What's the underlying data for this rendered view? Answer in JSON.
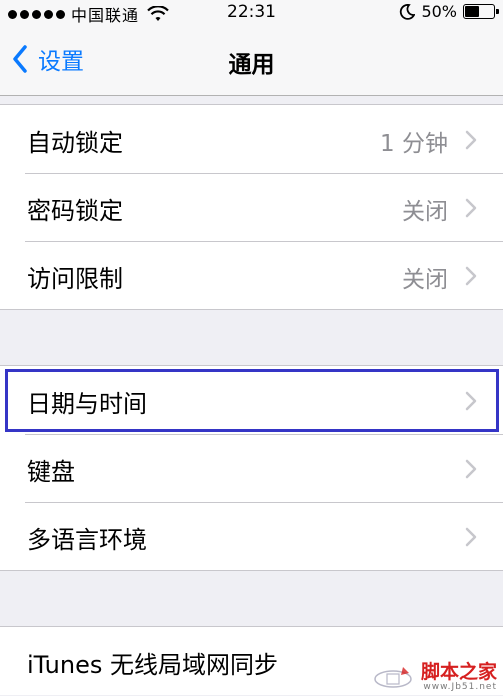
{
  "status_bar": {
    "carrier": "中国联通",
    "time": "22:31",
    "battery_percent_label": "50%",
    "battery_level": 0.5,
    "icons": [
      "signal-dots-icon",
      "wifi-icon",
      "moon-icon",
      "battery-icon"
    ]
  },
  "nav": {
    "back_label": "设置",
    "title": "通用"
  },
  "groups": [
    {
      "rows": [
        {
          "label": "自动锁定",
          "value": "1 分钟"
        },
        {
          "label": "密码锁定",
          "value": "关闭"
        },
        {
          "label": "访问限制",
          "value": "关闭"
        }
      ]
    },
    {
      "rows": [
        {
          "label": "日期与时间",
          "value": ""
        },
        {
          "label": "键盘",
          "value": ""
        },
        {
          "label": "多语言环境",
          "value": ""
        }
      ]
    },
    {
      "rows": [
        {
          "label": "iTunes 无线局域网同步",
          "value": ""
        }
      ]
    }
  ],
  "watermark": {
    "title": "脚本之家",
    "url": "www.Jb51.net"
  },
  "colors": {
    "accent": "#0a7aff",
    "highlight_border": "#3535c6",
    "background": "#efeff4",
    "secondary_text": "#8e8e93",
    "watermark_red": "#d62020"
  }
}
